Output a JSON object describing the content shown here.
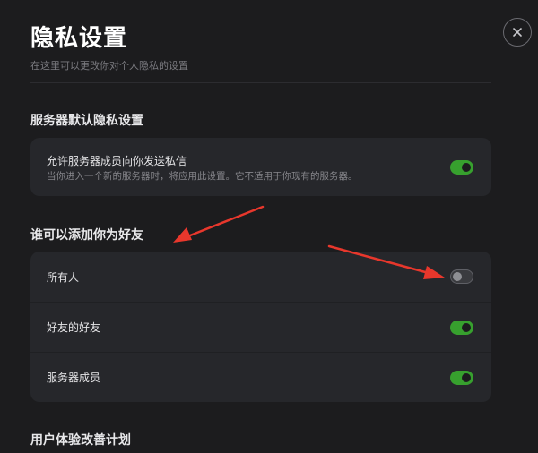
{
  "header": {
    "title": "隐私设置",
    "subtitle": "在这里可以更改你对个人隐私的设置",
    "close_icon": "close-icon"
  },
  "sections": {
    "server_privacy": {
      "title": "服务器默认隐私设置",
      "items": [
        {
          "label": "允许服务器成员向你发送私信",
          "description": "当你进入一个新的服务器时，将应用此设置。它不适用于你现有的服务器。",
          "enabled": true
        }
      ]
    },
    "friend_requests": {
      "title": "谁可以添加你为好友",
      "items": [
        {
          "label": "所有人",
          "enabled": false
        },
        {
          "label": "好友的好友",
          "enabled": true
        },
        {
          "label": "服务器成员",
          "enabled": true
        }
      ]
    },
    "ux_program": {
      "title": "用户体验改善计划"
    }
  },
  "colors": {
    "background": "#1c1c1e",
    "card": "#26272b",
    "toggle_on": "#37a02e",
    "annotation_arrow": "#e8372c"
  }
}
